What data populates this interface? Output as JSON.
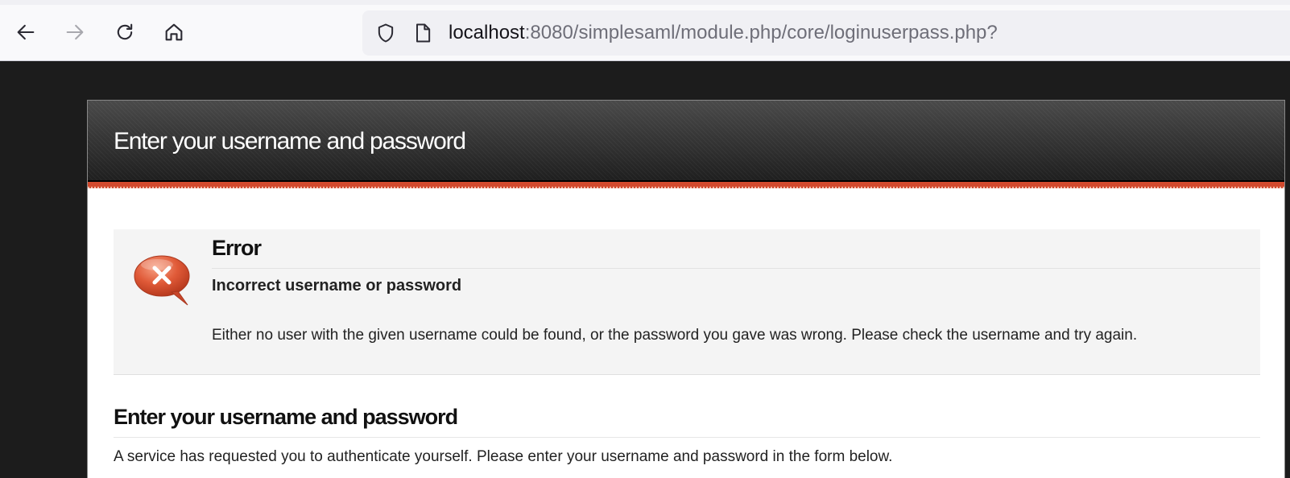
{
  "browser": {
    "url_host": "localhost",
    "url_rest": ":8080/simplesaml/module.php/core/loginuserpass.php?",
    "icons": {
      "back": "back-arrow-icon",
      "forward": "forward-arrow-icon",
      "reload": "reload-icon",
      "home": "home-icon",
      "shield": "shield-icon",
      "page": "page-icon"
    }
  },
  "page": {
    "header_title": "Enter your username and password",
    "accent_color": "#d24a2e",
    "error": {
      "icon": "error-bubble-icon",
      "title": "Error",
      "subtitle": "Incorrect username or password",
      "description": "Either no user with the given username could be found, or the password you gave was wrong. Please check the username and try again."
    },
    "login": {
      "heading": "Enter your username and password",
      "intro": "A service has requested you to authenticate yourself. Please enter your username and password in the form below."
    }
  }
}
